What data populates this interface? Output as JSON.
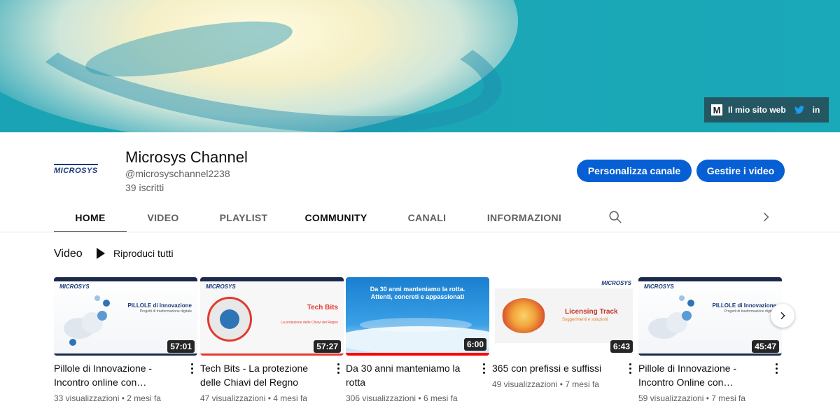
{
  "banner": {
    "links_label": "Il mio sito web",
    "m_logo": "M",
    "linkedin": "in"
  },
  "channel": {
    "logo_text": "MICROSYS",
    "title": "Microsys Channel",
    "handle": "@microsyschannel2238",
    "subscribers": "39 iscritti",
    "customize_label": "Personalizza canale",
    "manage_label": "Gestire i video"
  },
  "tabs": [
    {
      "label": "HOME",
      "active": true
    },
    {
      "label": "VIDEO"
    },
    {
      "label": "PLAYLIST"
    },
    {
      "label": "COMMUNITY"
    },
    {
      "label": "CANALI"
    },
    {
      "label": "INFORMAZIONI"
    }
  ],
  "section": {
    "title": "Video",
    "play_all": "Riproduci tutti"
  },
  "videos": [
    {
      "title": "Pillole di Innovazione - Incontro online con Bignami…",
      "views": "33 visualizzazioni",
      "age": "2 mesi fa",
      "duration": "57:01",
      "thumb_brand": "MICROSYS",
      "thumb_heading": "PILLOLE di Innovazione",
      "thumb_sub": "Progetti di trasformazione digitale"
    },
    {
      "title": "Tech Bits - La protezione delle Chiavi del Regno",
      "views": "47 visualizzazioni",
      "age": "4 mesi fa",
      "duration": "57:27",
      "thumb_brand": "MICROSYS",
      "thumb_heading": "Tech Bits",
      "thumb_sub": "La protezione delle Chiavi del Regno"
    },
    {
      "title": "Da 30 anni manteniamo la rotta",
      "views": "306 visualizzazioni",
      "age": "6 mesi fa",
      "duration": "6:00",
      "progress": 1.0,
      "thumb_heading": "Da 30 anni manteniamo la rotta.",
      "thumb_sub": "Attenti, concreti e appassionati"
    },
    {
      "title": "365 con prefissi e suffissi",
      "views": "49 visualizzazioni",
      "age": "7 mesi fa",
      "duration": "6:43",
      "thumb_brand": "MICROSYS",
      "thumb_heading": "Licensing Track",
      "thumb_sub": "Suggerimenti e soluzioni"
    },
    {
      "title": "Pillole di Innovazione - Incontro Online con…",
      "views": "59 visualizzazioni",
      "age": "7 mesi fa",
      "duration": "45:47",
      "thumb_brand": "MICROSYS",
      "thumb_heading": "PILLOLE di Innovazione",
      "thumb_sub": "Progetti di trasformazione digitale"
    }
  ],
  "meta_separator": "•",
  "colors": {
    "accent": "#065fd4",
    "banner": "#1aa3b4",
    "progress": "#ff0000"
  },
  "icons": [
    "twitter-icon",
    "linkedin-icon",
    "search-icon",
    "chevron-right-icon",
    "play-icon",
    "more-vert-icon"
  ]
}
